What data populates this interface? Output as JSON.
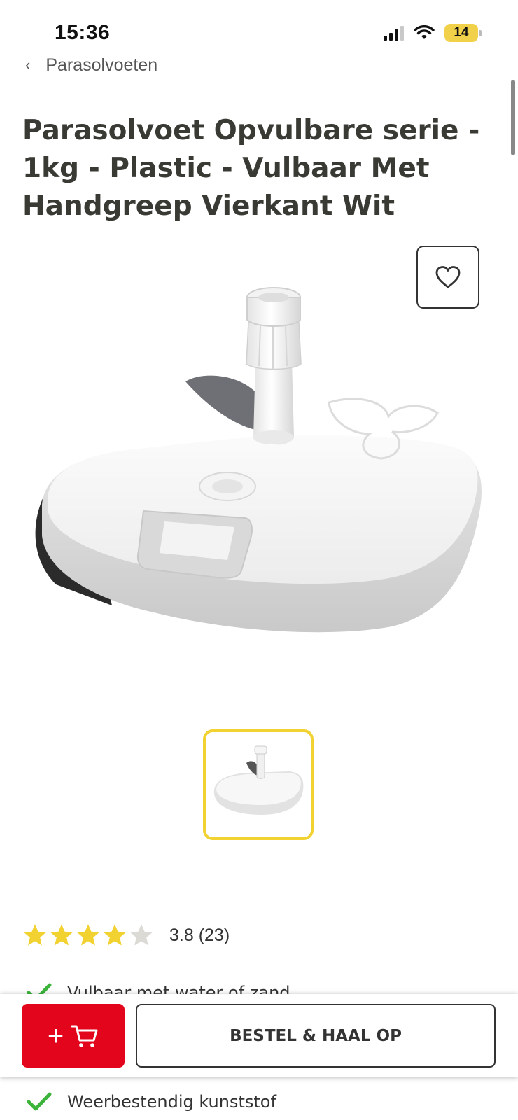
{
  "status_bar": {
    "time": "15:36",
    "battery": "14",
    "signal_icon": "signal-bars-icon",
    "wifi_icon": "wifi-icon",
    "battery_color": "#f1d14a"
  },
  "breadcrumb": {
    "back_icon": "chevron-left-icon",
    "label": "Parasolvoeten"
  },
  "product": {
    "title": "Parasolvoet Opvulbare serie - 1kg - Plastic - Vulbaar Met Handgreep Vierkant Wit",
    "favorite_icon": "heart-icon",
    "main_image": "white-square-parasol-base",
    "thumbnail_border_color": "#f2d230"
  },
  "rating": {
    "score": 3.8,
    "max": 5,
    "text": "3.8 (23)",
    "star_color": "#f2d230"
  },
  "usps": [
    {
      "icon": "checkmark-icon",
      "text": "Vulbaar met water of zand"
    },
    {
      "icon": "checkmark-icon",
      "text": "Weerbestendig kunststof"
    }
  ],
  "actions": {
    "cart_button": {
      "label": "+",
      "icon": "shopping-cart-icon",
      "color": "#e3051b"
    },
    "pickup_button": {
      "label": "BESTEL & HAAL OP"
    }
  }
}
